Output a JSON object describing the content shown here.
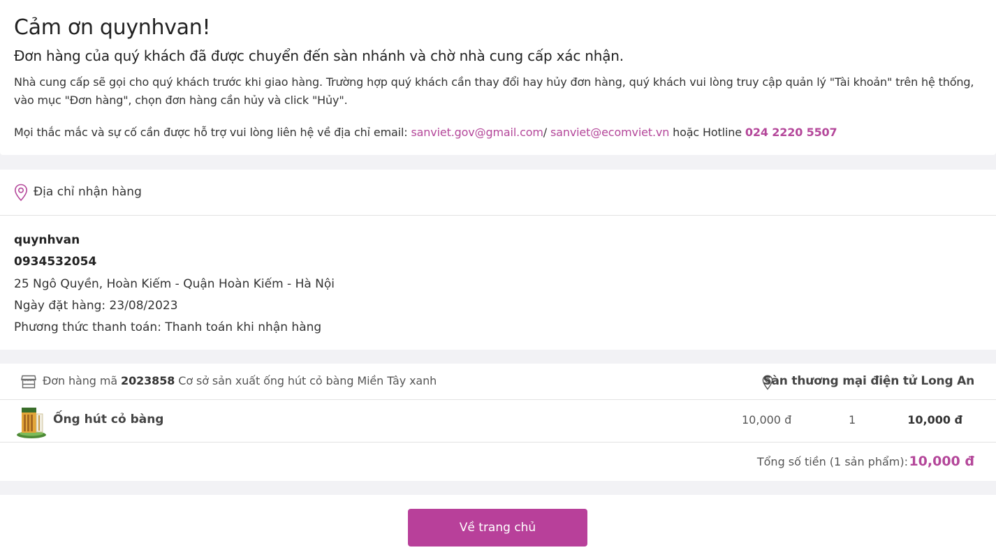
{
  "thanks": {
    "title": "Cảm ơn quynhvan!",
    "subtitle": "Đơn hàng của quý khách đã được chuyển đến sàn nhánh và chờ nhà cung cấp xác nhận.",
    "note": "Nhà cung cấp sẽ gọi cho quý khách trước khi giao hàng. Trường hợp quý khách cần thay đổi hay hủy đơn hàng, quý khách vui lòng truy cập quản lý \"Tài khoản\" trên hệ thống, vào mục \"Đơn hàng\", chọn đơn hàng cần hủy và click \"Hủy\".",
    "contact_prefix": "Mọi thắc mắc và sự cố cần được hỗ trợ vui lòng liên hệ về địa chỉ email: ",
    "email1": "sanviet.gov@gmail.com",
    "separator": "/ ",
    "email2": "sanviet@ecomviet.vn",
    "hotline_prefix": " hoặc Hotline ",
    "hotline": "024 2220 5507"
  },
  "address": {
    "title": "Địa chỉ nhận hàng",
    "name": "quynhvan",
    "phone": "0934532054",
    "street": "25 Ngô Quyền, Hoàn Kiếm - Quận Hoàn Kiếm - Hà Nội",
    "order_date": "Ngày đặt hàng: 23/08/2023",
    "payment": "Phương thức thanh toán: Thanh toán khi nhận hàng"
  },
  "order": {
    "prefix": "Đơn hàng mã ",
    "code": "2023858",
    "seller": " Cơ sở sản xuất ống hút cỏ bàng Miền Tây xanh",
    "marketplace": "Sàn thương mại điện tử Long An",
    "item": {
      "name": "Ống hút cỏ bàng",
      "price": "10,000 đ",
      "qty": "1",
      "subtotal": "10,000 đ"
    },
    "total_label": "Tổng số tiền (1 sản phẩm):",
    "total_value": "10,000 đ"
  },
  "footer": {
    "home_button": "Về trang chủ"
  },
  "colors": {
    "accent": "#b4479a",
    "button": "#b8409a",
    "background": "#f2f2f5"
  },
  "icons": {
    "address": "map-pin-icon",
    "store": "store-icon",
    "marketplace": "map-pin-icon"
  }
}
